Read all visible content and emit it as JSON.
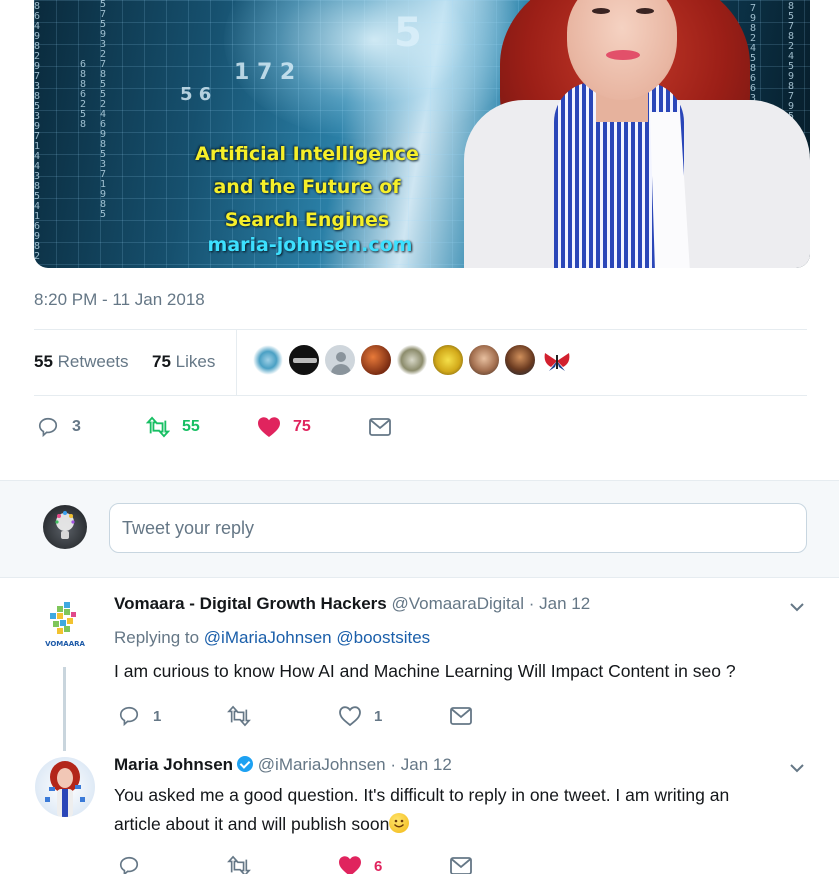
{
  "hero": {
    "headline_lines": [
      "Artificial Intelligence",
      "and the Future of",
      "Search Engines"
    ],
    "url": "maria-johnsen.com"
  },
  "tweet": {
    "timestamp": "8:20 PM - 11 Jan 2018",
    "retweets_count": "55",
    "retweets_label": "Retweets",
    "likes_count": "75",
    "likes_label": "Likes",
    "actions": {
      "replies": "3",
      "retweets": "55",
      "likes": "75"
    }
  },
  "reply_box": {
    "placeholder": "Tweet your reply"
  },
  "replies": [
    {
      "name": "Vomaara - Digital Growth Hackers",
      "handle": "@VomaaraDigital",
      "separator": "·",
      "date": "Jan 12",
      "replying_to_label": "Replying to",
      "replying_to": [
        "@iMariaJohnsen",
        "@boostsites"
      ],
      "text": "I am curious to know How AI and Machine Learning Will Impact Content in seo ?",
      "avatar_text": "VOMAARA",
      "actions": {
        "replies": "1",
        "retweets": "",
        "likes": "1"
      }
    },
    {
      "name": "Maria Johnsen",
      "handle": "@iMariaJohnsen",
      "separator": "·",
      "date": "Jan 12",
      "text_line1": "You asked me a good question. It's difficult to reply in one tweet. I am writing an",
      "text_line2": "article about it and will publish soon",
      "actions": {
        "replies": "",
        "retweets": "",
        "likes": "6"
      }
    }
  ],
  "colors": {
    "retweet_green": "#17bf63",
    "like_red": "#e0245e",
    "link_blue": "#1b5faa",
    "secondary_text": "#657786"
  }
}
